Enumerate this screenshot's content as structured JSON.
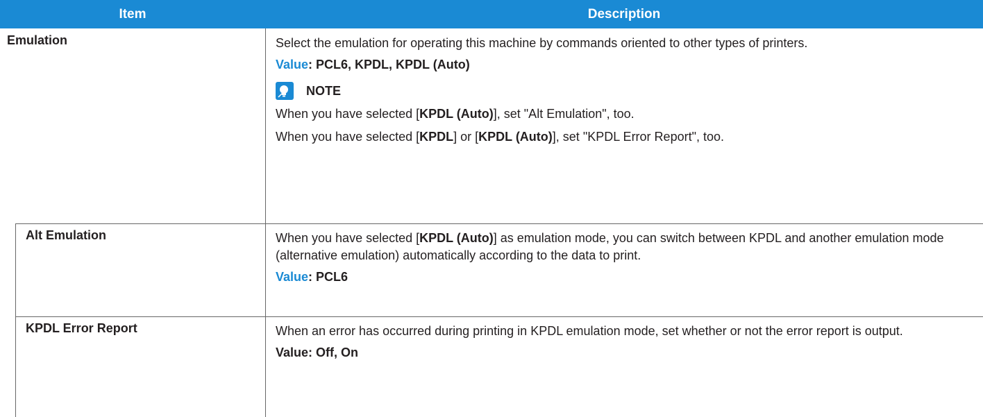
{
  "header": {
    "item": "Item",
    "description": "Description"
  },
  "emulation": {
    "item": "Emulation",
    "desc": "Select the emulation for operating this machine by commands oriented to other types of printers.",
    "value_label": "Value",
    "value_text": ": PCL6, KPDL, KPDL (Auto)",
    "note_label": "NOTE",
    "note1": {
      "pre": "When you have selected [",
      "b1": "KPDL (Auto)",
      "post": "], set \"Alt Emulation\", too."
    },
    "note2": {
      "pre": "When you have selected [",
      "b1": "KPDL",
      "mid": "] or [",
      "b2": "KPDL (Auto)",
      "post": "], set \"KPDL Error Report\", too."
    }
  },
  "alt_emulation": {
    "item": "Alt Emulation",
    "desc_pre": "When you have selected [",
    "desc_b": "KPDL (Auto)",
    "desc_post": "] as emulation mode, you can switch between KPDL and another emulation mode (alternative emulation) automatically according to the data to print.",
    "value_label": "Value",
    "value_text": ": PCL6"
  },
  "kpdl_error": {
    "item": "KPDL Error Report",
    "desc": "When an error has occurred during printing in KPDL emulation mode, set whether or not the error report is output.",
    "value_text": "Value: Off, On"
  },
  "colors": {
    "header_bg": "#1a8ad4",
    "accent": "#1a8ad4",
    "text": "#231f20"
  }
}
